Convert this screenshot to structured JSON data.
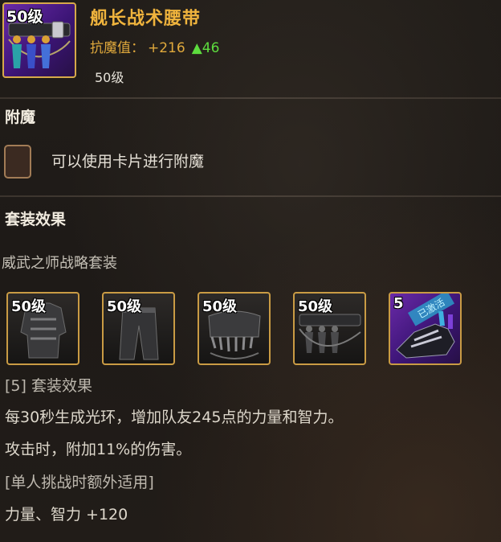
{
  "item": {
    "icon_name": "belt-icon",
    "level_tag": "50级",
    "name": "舰长战术腰带",
    "stat_label": "抗魔值：",
    "stat_value": "+216",
    "stat_up_icon": "▲",
    "stat_up_value": "46",
    "required_level": "50级"
  },
  "enchant": {
    "title": "附魔",
    "slot_icon": "card-slot-icon",
    "hint": "可以使用卡片进行附魔"
  },
  "set": {
    "title": "套装效果",
    "name": "威武之师战略套装",
    "pieces": [
      {
        "level": "50级",
        "icon": "coat-icon"
      },
      {
        "level": "50级",
        "icon": "pants-icon"
      },
      {
        "level": "50级",
        "icon": "shoulder-icon"
      },
      {
        "level": "50级",
        "icon": "belt-icon"
      },
      {
        "level": "5",
        "icon": "shoes-icon",
        "overlay_text": "已激活"
      }
    ],
    "effect_header": "[5] 套装效果",
    "effects": [
      "每30秒生成光环，增加队友245点的力量和智力。",
      "攻击时，附加11%的伤害。",
      "[单人挑战时额外适用]",
      "力量、智力 +120"
    ]
  },
  "colors": {
    "item_name": "#f0b43d",
    "stat": "#e0a93c",
    "stat_up": "#5ddc3e",
    "frame_gold": "#d6a94a",
    "epic_purple": "#5a22a0"
  }
}
